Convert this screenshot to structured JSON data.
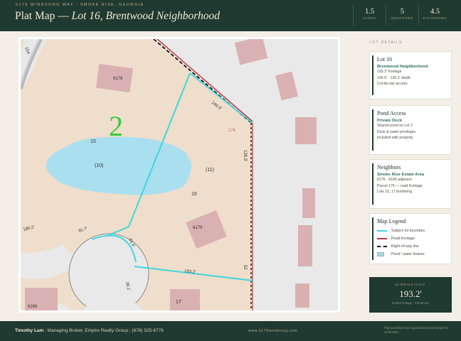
{
  "header": {
    "address": "6179 WINDSONG WAY · SMOKE RISE, GEORGIA",
    "title_prefix": "Plat Map — ",
    "title_lot": "Lot 16, Brentwood Neighborhood",
    "stats": [
      {
        "value": "1.5",
        "label": "ACRES"
      },
      {
        "value": "5",
        "label": "BEDROOMS"
      },
      {
        "value": "4.5",
        "label": "BATHROOMS"
      }
    ]
  },
  "map": {
    "big_label": "2",
    "lot_numbers": {
      "lot15": "15",
      "lot16": "16",
      "lot17": "17",
      "lot176": "176"
    },
    "parcel_notes": {
      "pond": "(10)",
      "lot": "(11)"
    },
    "house_numbers": {
      "h6176": "6176",
      "h6179": "6179",
      "h6166": "6166"
    },
    "dimensions": {
      "top": "146.5'",
      "right": "126.3'",
      "bottom": "193.2'",
      "left_a": "185.2'",
      "curve_a": "91.7'",
      "curve_b": "81.6'",
      "curve_c": "39.1'",
      "corner_a": "154",
      "corner_b": "52"
    },
    "colors": {
      "lot": "#eedecb",
      "road": "#e9e9e9",
      "pond": "#aadff0",
      "boundary": "#41d6dc",
      "houses": "#dab1b2",
      "green_label": "#3cc93c",
      "road_frontage": "#c0393b"
    }
  },
  "sidebar": {
    "heading": "LOT DETAILS",
    "cards": [
      {
        "title": "Lot 16",
        "subtitle": "Brentwood Neighborhood",
        "lines": [
          "193.2' frontage",
          "146.5' · 126.3' depth",
          "Cul-de-sac access"
        ]
      },
      {
        "title": "Pond Access",
        "subtitle": "Private Dock",
        "lines": [
          "Shared pond on Lot 2",
          "Dock & water privileges",
          "included with property"
        ]
      },
      {
        "title": "Neighbors",
        "subtitle": "Smoke Rise Estate Area",
        "lines": [
          "6176 · 6166 adjacent",
          "Parcel 176 — road frontage",
          "Lots 15, 17 bordering"
        ]
      }
    ],
    "legend": {
      "title": "Map Legend",
      "items": [
        {
          "label": "Subject lot boundary",
          "icon": "cyan-line-icon",
          "color": "#41d6dc"
        },
        {
          "label": "Road frontage",
          "icon": "red-line-icon",
          "color": "#b23b3d"
        },
        {
          "label": "Right-of-way line",
          "icon": "dashed-line-icon",
          "color": "#111111"
        },
        {
          "label": "Pond / water feature",
          "icon": "pond-swatch-icon",
          "color": "#a8d8e8"
        }
      ]
    },
    "dimensions_panel": {
      "label": "DIMENSIONS",
      "value": "193.2'",
      "caption": "Road Frontage · Cul-de-sac"
    }
  },
  "footer": {
    "agent_name": "Timothy Lam",
    "agent_role": "Managing Broker, Empire Realty Group",
    "phone": "(678) 525-6776",
    "website": "www.6179windsong.com",
    "disclaimer": "Plat boundaries are approximate and subject to verification"
  }
}
